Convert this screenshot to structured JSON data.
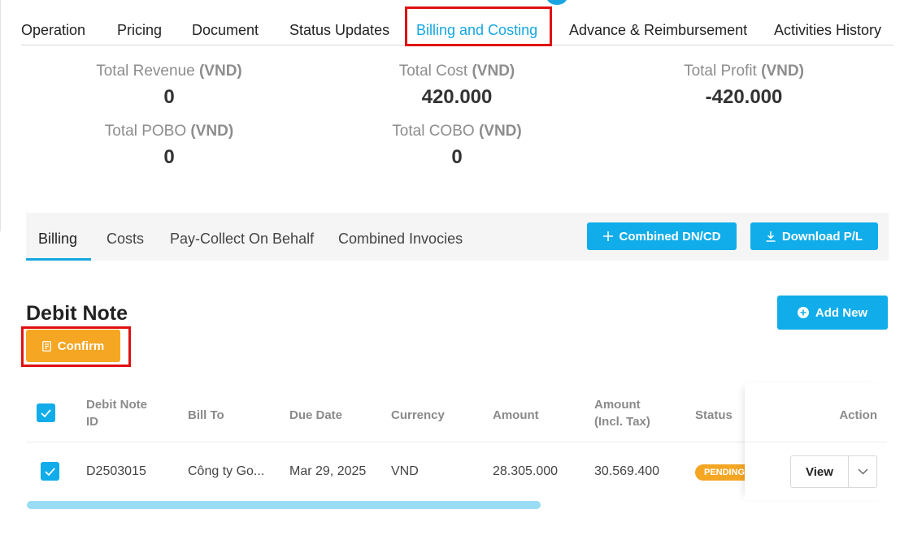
{
  "top_tabs": [
    {
      "label": "Operation"
    },
    {
      "label": "Pricing"
    },
    {
      "label": "Document"
    },
    {
      "label": "Status Updates"
    },
    {
      "label": "Billing and Costing",
      "active": true
    },
    {
      "label": "Advance & Reimbursement"
    },
    {
      "label": "Activities History"
    }
  ],
  "summary": {
    "revenue": {
      "label": "Total Revenue",
      "unit": "(VND)",
      "value": "0"
    },
    "cost": {
      "label": "Total Cost",
      "unit": "(VND)",
      "value": "420.000"
    },
    "profit": {
      "label": "Total Profit",
      "unit": "(VND)",
      "value": "-420.000"
    },
    "pobo": {
      "label": "Total POBO",
      "unit": "(VND)",
      "value": "0"
    },
    "cobo": {
      "label": "Total COBO",
      "unit": "(VND)",
      "value": "0"
    }
  },
  "sub_tabs": [
    {
      "label": "Billing",
      "active": true
    },
    {
      "label": "Costs"
    },
    {
      "label": "Pay-Collect On Behalf"
    },
    {
      "label": "Combined Invocies"
    }
  ],
  "toolbar": {
    "combined_label": "Combined DN/CD",
    "download_label": "Download P/L"
  },
  "section": {
    "title": "Debit Note",
    "add_new_label": "Add New",
    "confirm_label": "Confirm"
  },
  "table": {
    "headers": {
      "id": [
        "Debit Note",
        "ID"
      ],
      "bill_to": "Bill To",
      "due_date": "Due Date",
      "currency": "Currency",
      "amount": "Amount",
      "amount_tax": [
        "Amount",
        "(Incl. Tax)"
      ],
      "status": "Status",
      "action": "Action"
    },
    "rows": [
      {
        "id": "D2503015",
        "bill_to": "Công ty Go...",
        "due_date": "Mar 29, 2025",
        "currency": "VND",
        "amount": "28.305.000",
        "amount_tax": "30.569.400",
        "status": "PENDING",
        "view_label": "View"
      }
    ]
  },
  "colors": {
    "accent": "#10adea",
    "warning": "#f5a623",
    "highlight": "#e01010"
  }
}
